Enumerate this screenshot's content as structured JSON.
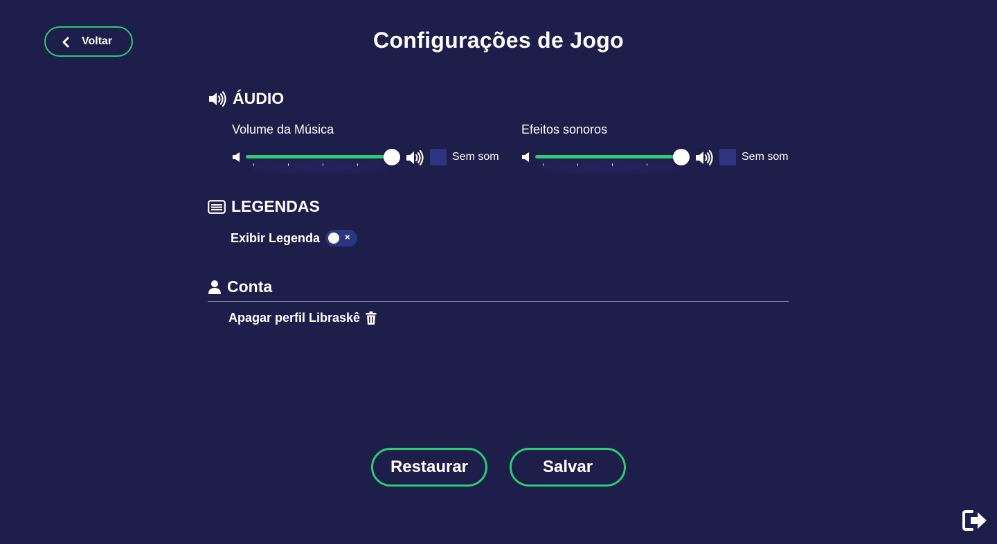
{
  "header": {
    "back_label": "Voltar",
    "title": "Configurações de Jogo"
  },
  "audio": {
    "heading": "ÁUDIO",
    "music": {
      "label": "Volume da Música",
      "volume": 1.0,
      "mute_label": "Sem som",
      "muted": false
    },
    "effects": {
      "label": "Efeitos sonoros",
      "volume": 1.0,
      "mute_label": "Sem som",
      "muted": false
    }
  },
  "subtitles": {
    "heading": "LEGENDAS",
    "toggle_label": "Exibir Legenda",
    "enabled": false,
    "toggle_icon": "×"
  },
  "account": {
    "heading": "Conta",
    "delete_label": "Apagar perfil Libraskê"
  },
  "actions": {
    "restore_label": "Restaurar",
    "save_label": "Salvar"
  },
  "colors": {
    "background": "#1e1e4b",
    "accent": "#2ecc71",
    "control": "#2e3580"
  },
  "icons": [
    "chevron-left-icon",
    "speaker-icon",
    "subtitles-icon",
    "user-icon",
    "trash-icon",
    "exit-icon"
  ]
}
